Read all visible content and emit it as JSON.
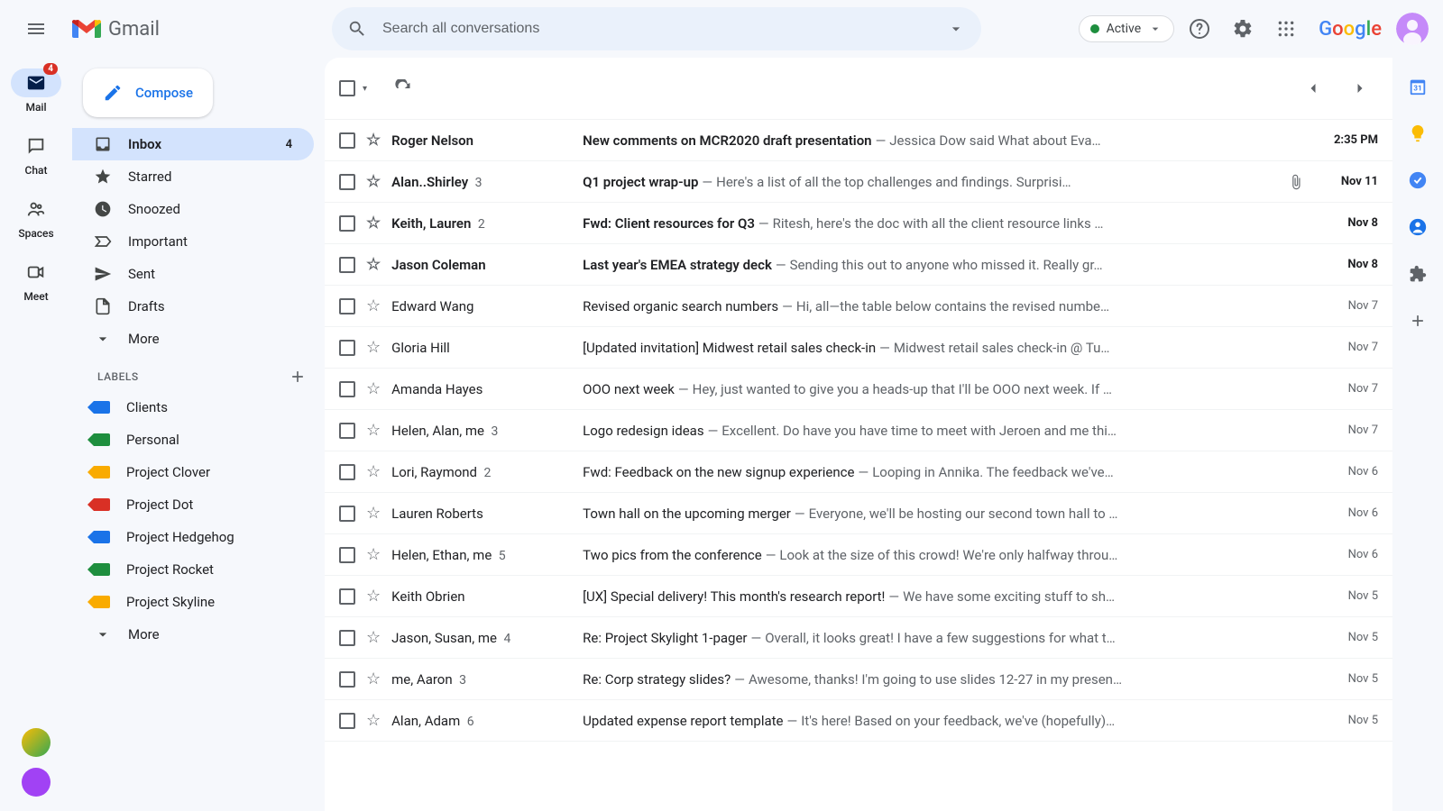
{
  "header": {
    "app_name": "Gmail",
    "search_placeholder": "Search all conversations",
    "active_label": "Active",
    "google_text": "Google"
  },
  "rail": {
    "mail": "Mail",
    "mail_badge": "4",
    "chat": "Chat",
    "spaces": "Spaces",
    "meet": "Meet"
  },
  "sidebar": {
    "compose": "Compose",
    "nav": [
      {
        "label": "Inbox",
        "count": "4",
        "selected": true,
        "icon": "inbox"
      },
      {
        "label": "Starred",
        "icon": "star"
      },
      {
        "label": "Snoozed",
        "icon": "clock"
      },
      {
        "label": "Important",
        "icon": "important"
      },
      {
        "label": "Sent",
        "icon": "send"
      },
      {
        "label": "Drafts",
        "icon": "draft"
      },
      {
        "label": "More",
        "icon": "expand"
      }
    ],
    "labels_header": "LABELS",
    "labels": [
      {
        "name": "Clients",
        "color": "#1a73e8"
      },
      {
        "name": "Personal",
        "color": "#1e8e3e"
      },
      {
        "name": "Project Clover",
        "color": "#f9ab00"
      },
      {
        "name": "Project Dot",
        "color": "#d93025"
      },
      {
        "name": "Project Hedgehog",
        "color": "#1a73e8"
      },
      {
        "name": "Project Rocket",
        "color": "#1e8e3e"
      },
      {
        "name": "Project Skyline",
        "color": "#f9ab00"
      }
    ],
    "more": "More"
  },
  "mails": [
    {
      "unread": true,
      "sender": "Roger Nelson",
      "count": "",
      "subject": "New comments on MCR2020 draft presentation",
      "preview": "Jessica Dow said What about Eva…",
      "date": "2:35 PM",
      "attach": false
    },
    {
      "unread": true,
      "sender": "Alan..Shirley",
      "count": "3",
      "subject": "Q1 project wrap-up",
      "preview": "Here's a list of all the top challenges and findings. Surprisi…",
      "date": "Nov 11",
      "attach": true
    },
    {
      "unread": true,
      "sender": "Keith, Lauren",
      "count": "2",
      "subject": "Fwd: Client resources for Q3",
      "preview": "Ritesh, here's the doc with all the client resource links …",
      "date": "Nov 8",
      "attach": false
    },
    {
      "unread": true,
      "sender": "Jason Coleman",
      "count": "",
      "subject": "Last year's EMEA strategy deck",
      "preview": "Sending this out to anyone who missed it. Really gr…",
      "date": "Nov 8",
      "attach": false
    },
    {
      "unread": false,
      "sender": "Edward Wang",
      "count": "",
      "subject": "Revised organic search numbers",
      "preview": "Hi, all—the table below contains the revised numbe…",
      "date": "Nov 7",
      "attach": false
    },
    {
      "unread": false,
      "sender": "Gloria Hill",
      "count": "",
      "subject": "[Updated invitation] Midwest retail sales check-in",
      "preview": "Midwest retail sales check-in @ Tu…",
      "date": "Nov 7",
      "attach": false
    },
    {
      "unread": false,
      "sender": "Amanda Hayes",
      "count": "",
      "subject": "OOO next week",
      "preview": "Hey, just wanted to give you a heads-up that I'll be OOO next week. If …",
      "date": "Nov 7",
      "attach": false
    },
    {
      "unread": false,
      "sender": "Helen, Alan, me",
      "count": "3",
      "subject": "Logo redesign ideas",
      "preview": "Excellent. Do have you have time to meet with Jeroen and me thi…",
      "date": "Nov 7",
      "attach": false
    },
    {
      "unread": false,
      "sender": "Lori, Raymond",
      "count": "2",
      "subject": "Fwd: Feedback on the new signup experience",
      "preview": "Looping in Annika. The feedback we've…",
      "date": "Nov 6",
      "attach": false
    },
    {
      "unread": false,
      "sender": "Lauren Roberts",
      "count": "",
      "subject": "Town hall on the upcoming merger",
      "preview": "Everyone, we'll be hosting our second town hall to …",
      "date": "Nov 6",
      "attach": false
    },
    {
      "unread": false,
      "sender": "Helen, Ethan, me",
      "count": "5",
      "subject": "Two pics from the conference",
      "preview": "Look at the size of this crowd! We're only halfway throu…",
      "date": "Nov 6",
      "attach": false
    },
    {
      "unread": false,
      "sender": "Keith Obrien",
      "count": "",
      "subject": "[UX] Special delivery! This month's research report!",
      "preview": "We have some exciting stuff to sh…",
      "date": "Nov 5",
      "attach": false
    },
    {
      "unread": false,
      "sender": "Jason, Susan, me",
      "count": "4",
      "subject": "Re: Project Skylight 1-pager",
      "preview": "Overall, it looks great! I have a few suggestions for what t…",
      "date": "Nov 5",
      "attach": false
    },
    {
      "unread": false,
      "sender": "me, Aaron",
      "count": "3",
      "subject": "Re: Corp strategy slides?",
      "preview": "Awesome, thanks! I'm going to use slides 12-27 in my presen…",
      "date": "Nov 5",
      "attach": false
    },
    {
      "unread": false,
      "sender": "Alan, Adam",
      "count": "6",
      "subject": "Updated expense report template",
      "preview": "It's here! Based on your feedback, we've (hopefully)…",
      "date": "Nov 5",
      "attach": false
    }
  ]
}
